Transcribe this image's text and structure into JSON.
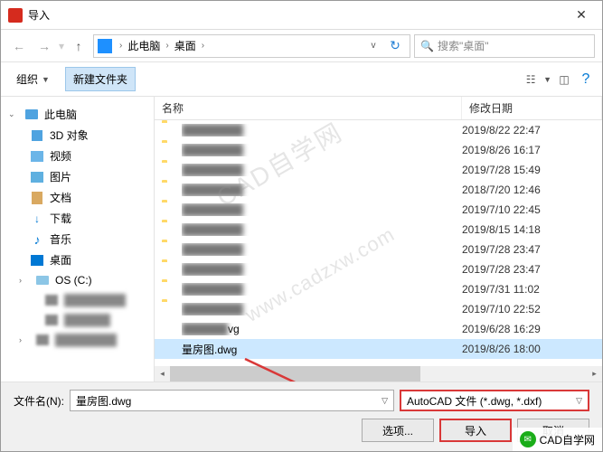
{
  "titlebar": {
    "title": "导入"
  },
  "nav": {
    "path": [
      "此电脑",
      "桌面"
    ],
    "search_placeholder": "搜索\"桌面\""
  },
  "toolbar": {
    "organize": "组织",
    "new_folder": "新建文件夹"
  },
  "sidebar": {
    "items": [
      {
        "label": "此电脑",
        "icon": "pc",
        "level": 1,
        "expanded": true
      },
      {
        "label": "3D 对象",
        "icon": "3d",
        "level": 2
      },
      {
        "label": "视频",
        "icon": "video",
        "level": 2
      },
      {
        "label": "图片",
        "icon": "pic",
        "level": 2
      },
      {
        "label": "文档",
        "icon": "doc",
        "level": 2
      },
      {
        "label": "下载",
        "icon": "dl",
        "level": 2
      },
      {
        "label": "音乐",
        "icon": "music",
        "level": 2
      },
      {
        "label": "桌面",
        "icon": "desk",
        "level": 2
      },
      {
        "label": "OS (C:)",
        "icon": "drive",
        "level": 2,
        "expandable": true
      }
    ]
  },
  "list": {
    "col_name": "名称",
    "col_date": "修改日期",
    "rows": [
      {
        "date": "2019/8/22 22:47",
        "type": "folder"
      },
      {
        "date": "2019/8/26 16:17",
        "type": "folder"
      },
      {
        "date": "2019/7/28 15:49",
        "type": "folder"
      },
      {
        "date": "2018/7/20 12:46",
        "type": "folder"
      },
      {
        "date": "2019/7/10 22:45",
        "type": "folder"
      },
      {
        "date": "2019/8/15 14:18",
        "type": "folder"
      },
      {
        "date": "2019/7/28 23:47",
        "type": "folder"
      },
      {
        "date": "2019/7/28 23:47",
        "type": "folder"
      },
      {
        "date": "2019/7/31 11:02",
        "type": "folder"
      },
      {
        "date": "2019/7/10 22:52",
        "type": "folder"
      },
      {
        "name_suffix": "vg",
        "date": "2019/6/28 16:29",
        "type": "file"
      },
      {
        "name": "量房图.dwg",
        "date": "2019/8/26 18:00",
        "type": "dwg",
        "selected": true
      }
    ]
  },
  "footer": {
    "filename_label": "文件名(N):",
    "filename_value": "量房图.dwg",
    "filter": "AutoCAD 文件 (*.dwg, *.dxf)",
    "options_btn": "选项...",
    "import_btn": "导入",
    "cancel_btn": "取消"
  },
  "watermark": {
    "line1": "CAD自学网",
    "line2": "www.cadzxw.com"
  },
  "badge": {
    "text": "CAD自学网"
  }
}
